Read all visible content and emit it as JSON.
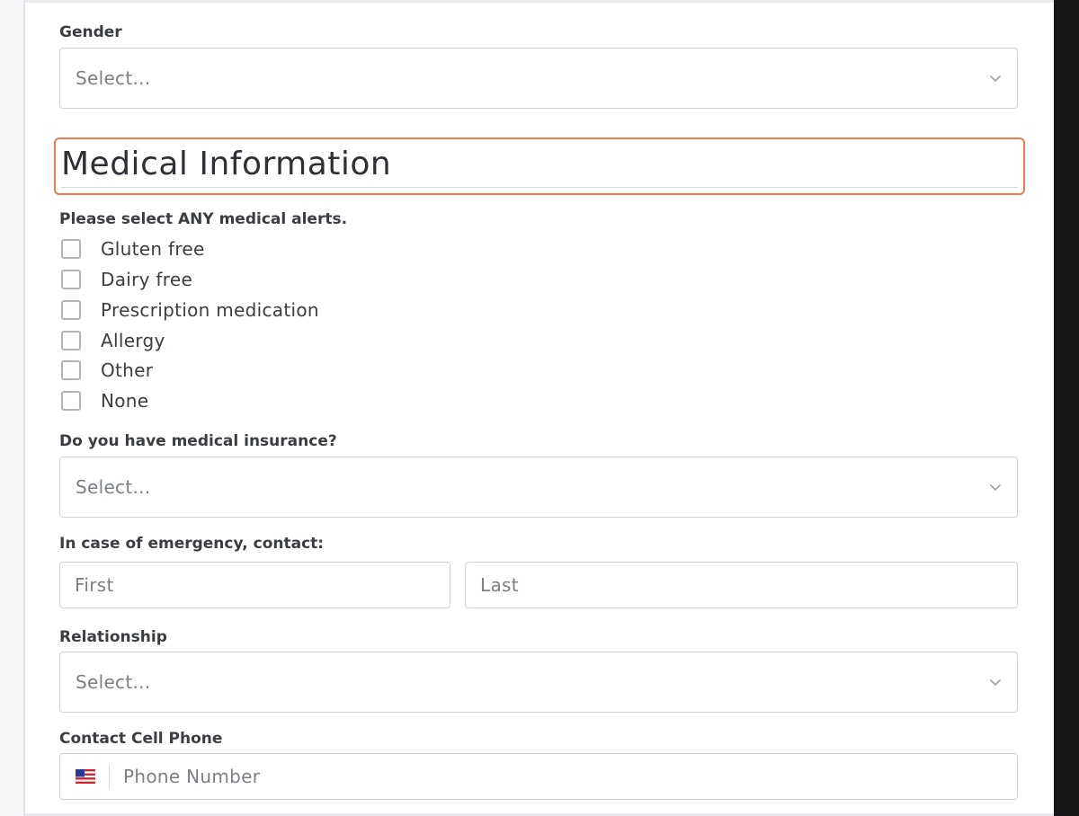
{
  "gender": {
    "label": "Gender",
    "placeholder": "Select..."
  },
  "section": {
    "title": "Medical Information"
  },
  "medical_alerts": {
    "label": "Please select ANY medical alerts.",
    "options": [
      "Gluten free",
      "Dairy free",
      "Prescription medication",
      "Allergy",
      "Other",
      "None"
    ]
  },
  "insurance": {
    "label": "Do you have medical insurance?",
    "placeholder": "Select..."
  },
  "emergency": {
    "label": "In case of emergency, contact:",
    "first_placeholder": "First",
    "last_placeholder": "Last"
  },
  "relationship": {
    "label": "Relationship",
    "placeholder": "Select..."
  },
  "cell_phone": {
    "label": "Contact Cell Phone",
    "placeholder": "Phone Number",
    "flag_icon": "us-flag-icon"
  },
  "colors": {
    "focus_outline": "#f07c45",
    "border": "#cfd3d8",
    "label_text": "#3a3d42",
    "placeholder": "#7b8087"
  }
}
